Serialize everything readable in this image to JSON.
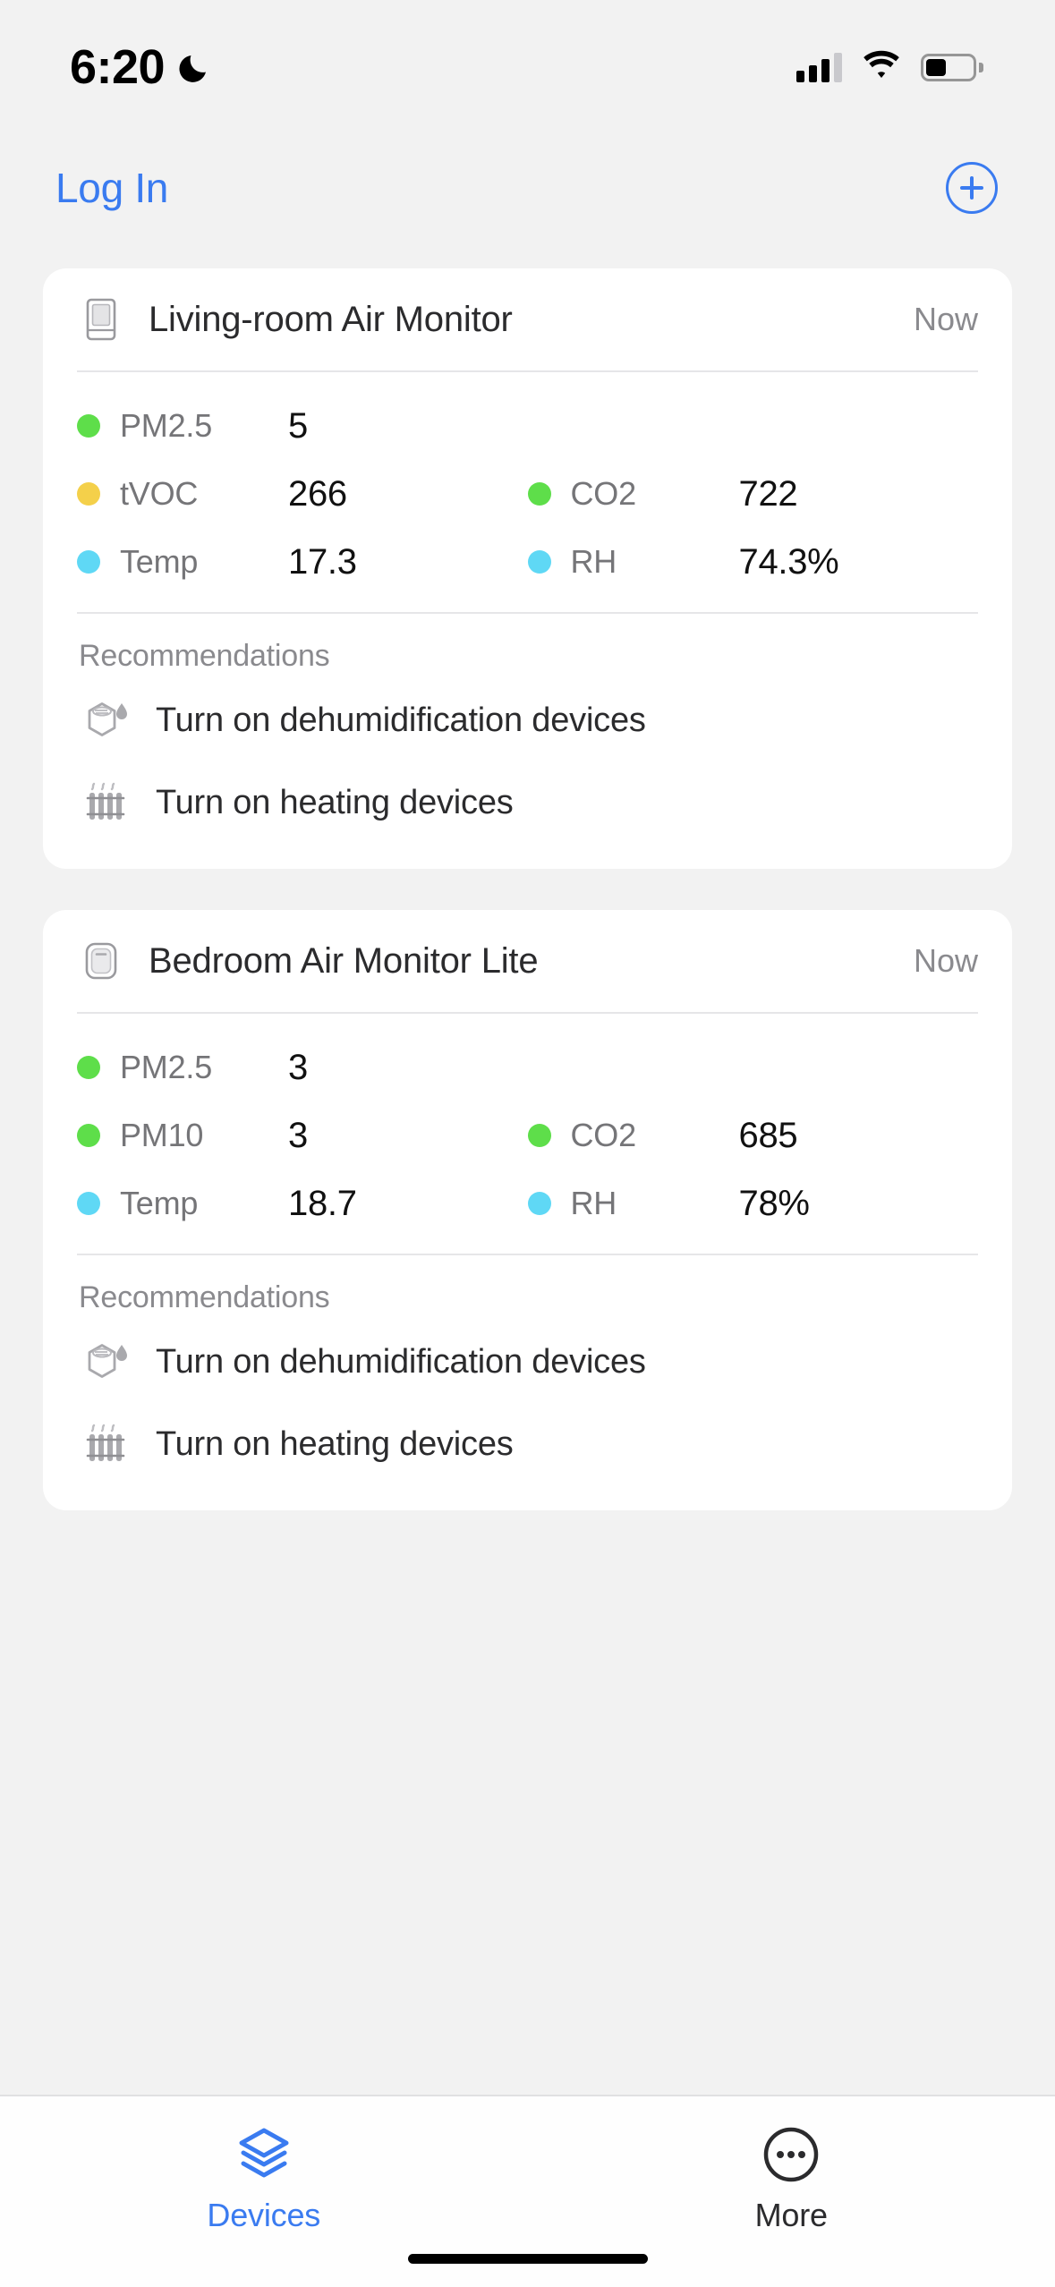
{
  "status_bar": {
    "time": "6:20",
    "icons": [
      "moon-icon",
      "cellular-signal-icon",
      "wifi-icon",
      "battery-icon"
    ],
    "battery_level": 35
  },
  "nav": {
    "login_label": "Log In",
    "add_icon": "plus-circle-icon"
  },
  "colors": {
    "accent_blue": "#3a7bf0",
    "good_green": "#5ede4a",
    "moderate_yellow": "#f4d04a",
    "temp_cyan": "#5fd8f5",
    "page_background": "#f2f2f2",
    "card_background": "#ffffff"
  },
  "devices": [
    {
      "name": "Living-room Air Monitor",
      "icon": "air-monitor-icon",
      "timestamp": "Now",
      "metrics": [
        {
          "label": "PM2.5",
          "value": "5",
          "status_color": "#5ede4a"
        },
        {
          "label": "tVOC",
          "value": "266",
          "status_color": "#f4d04a"
        },
        {
          "label": "CO2",
          "value": "722",
          "status_color": "#5ede4a"
        },
        {
          "label": "Temp",
          "value": "17.3",
          "status_color": "#5fd8f5"
        },
        {
          "label": "RH",
          "value": "74.3%",
          "status_color": "#5fd8f5"
        }
      ],
      "recommendations_title": "Recommendations",
      "recommendations": [
        {
          "icon": "dehumidifier-icon",
          "text": "Turn on dehumidification devices"
        },
        {
          "icon": "radiator-icon",
          "text": "Turn on heating devices"
        }
      ]
    },
    {
      "name": "Bedroom Air Monitor Lite",
      "icon": "air-monitor-lite-icon",
      "timestamp": "Now",
      "metrics": [
        {
          "label": "PM2.5",
          "value": "3",
          "status_color": "#5ede4a"
        },
        {
          "label": "PM10",
          "value": "3",
          "status_color": "#5ede4a"
        },
        {
          "label": "CO2",
          "value": "685",
          "status_color": "#5ede4a"
        },
        {
          "label": "Temp",
          "value": "18.7",
          "status_color": "#5fd8f5"
        },
        {
          "label": "RH",
          "value": "78%",
          "status_color": "#5fd8f5"
        }
      ],
      "recommendations_title": "Recommendations",
      "recommendations": [
        {
          "icon": "dehumidifier-icon",
          "text": "Turn on dehumidification devices"
        },
        {
          "icon": "radiator-icon",
          "text": "Turn on heating devices"
        }
      ]
    }
  ],
  "tabbar": {
    "tabs": [
      {
        "label": "Devices",
        "icon": "layers-icon",
        "active": true
      },
      {
        "label": "More",
        "icon": "ellipsis-circle-icon",
        "active": false
      }
    ]
  }
}
